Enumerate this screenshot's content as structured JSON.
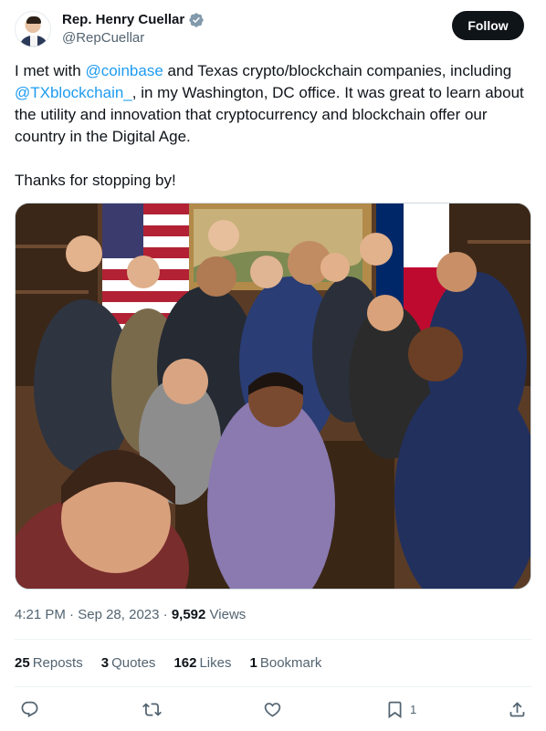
{
  "author": {
    "display_name": "Rep. Henry Cuellar",
    "handle": "@RepCuellar",
    "avatar_icon": "profile-avatar",
    "verified_icon": "verified-badge-icon",
    "verified_color": "#829aab"
  },
  "follow_label": "Follow",
  "tweet": {
    "part1": "I met with ",
    "mention1": "@coinbase",
    "part2": " and Texas crypto/blockchain companies, including ",
    "mention2": "@TXblockchain_",
    "part3": ", in my Washington, DC office. It was great to learn about the utility and innovation that cryptocurrency and blockchain offer our country in the Digital Age.",
    "paragraph2": "Thanks for stopping by!"
  },
  "meta": {
    "time": "4:21 PM",
    "separator": "·",
    "date": "Sep 28, 2023",
    "views_count": "9,592",
    "views_label": "Views"
  },
  "stats": {
    "reposts_count": "25",
    "reposts_label": "Reposts",
    "quotes_count": "3",
    "quotes_label": "Quotes",
    "likes_count": "162",
    "likes_label": "Likes",
    "bookmarks_count": "1",
    "bookmarks_label": "Bookmark"
  },
  "actions": {
    "reply_icon": "reply-icon",
    "repost_icon": "repost-icon",
    "like_icon": "like-icon",
    "bookmark_icon": "bookmark-icon",
    "bookmark_count": "1",
    "share_icon": "share-icon"
  },
  "colors": {
    "link": "#1d9bf0",
    "text": "#0f1419",
    "secondary": "#536471",
    "button_bg": "#0f1419"
  }
}
